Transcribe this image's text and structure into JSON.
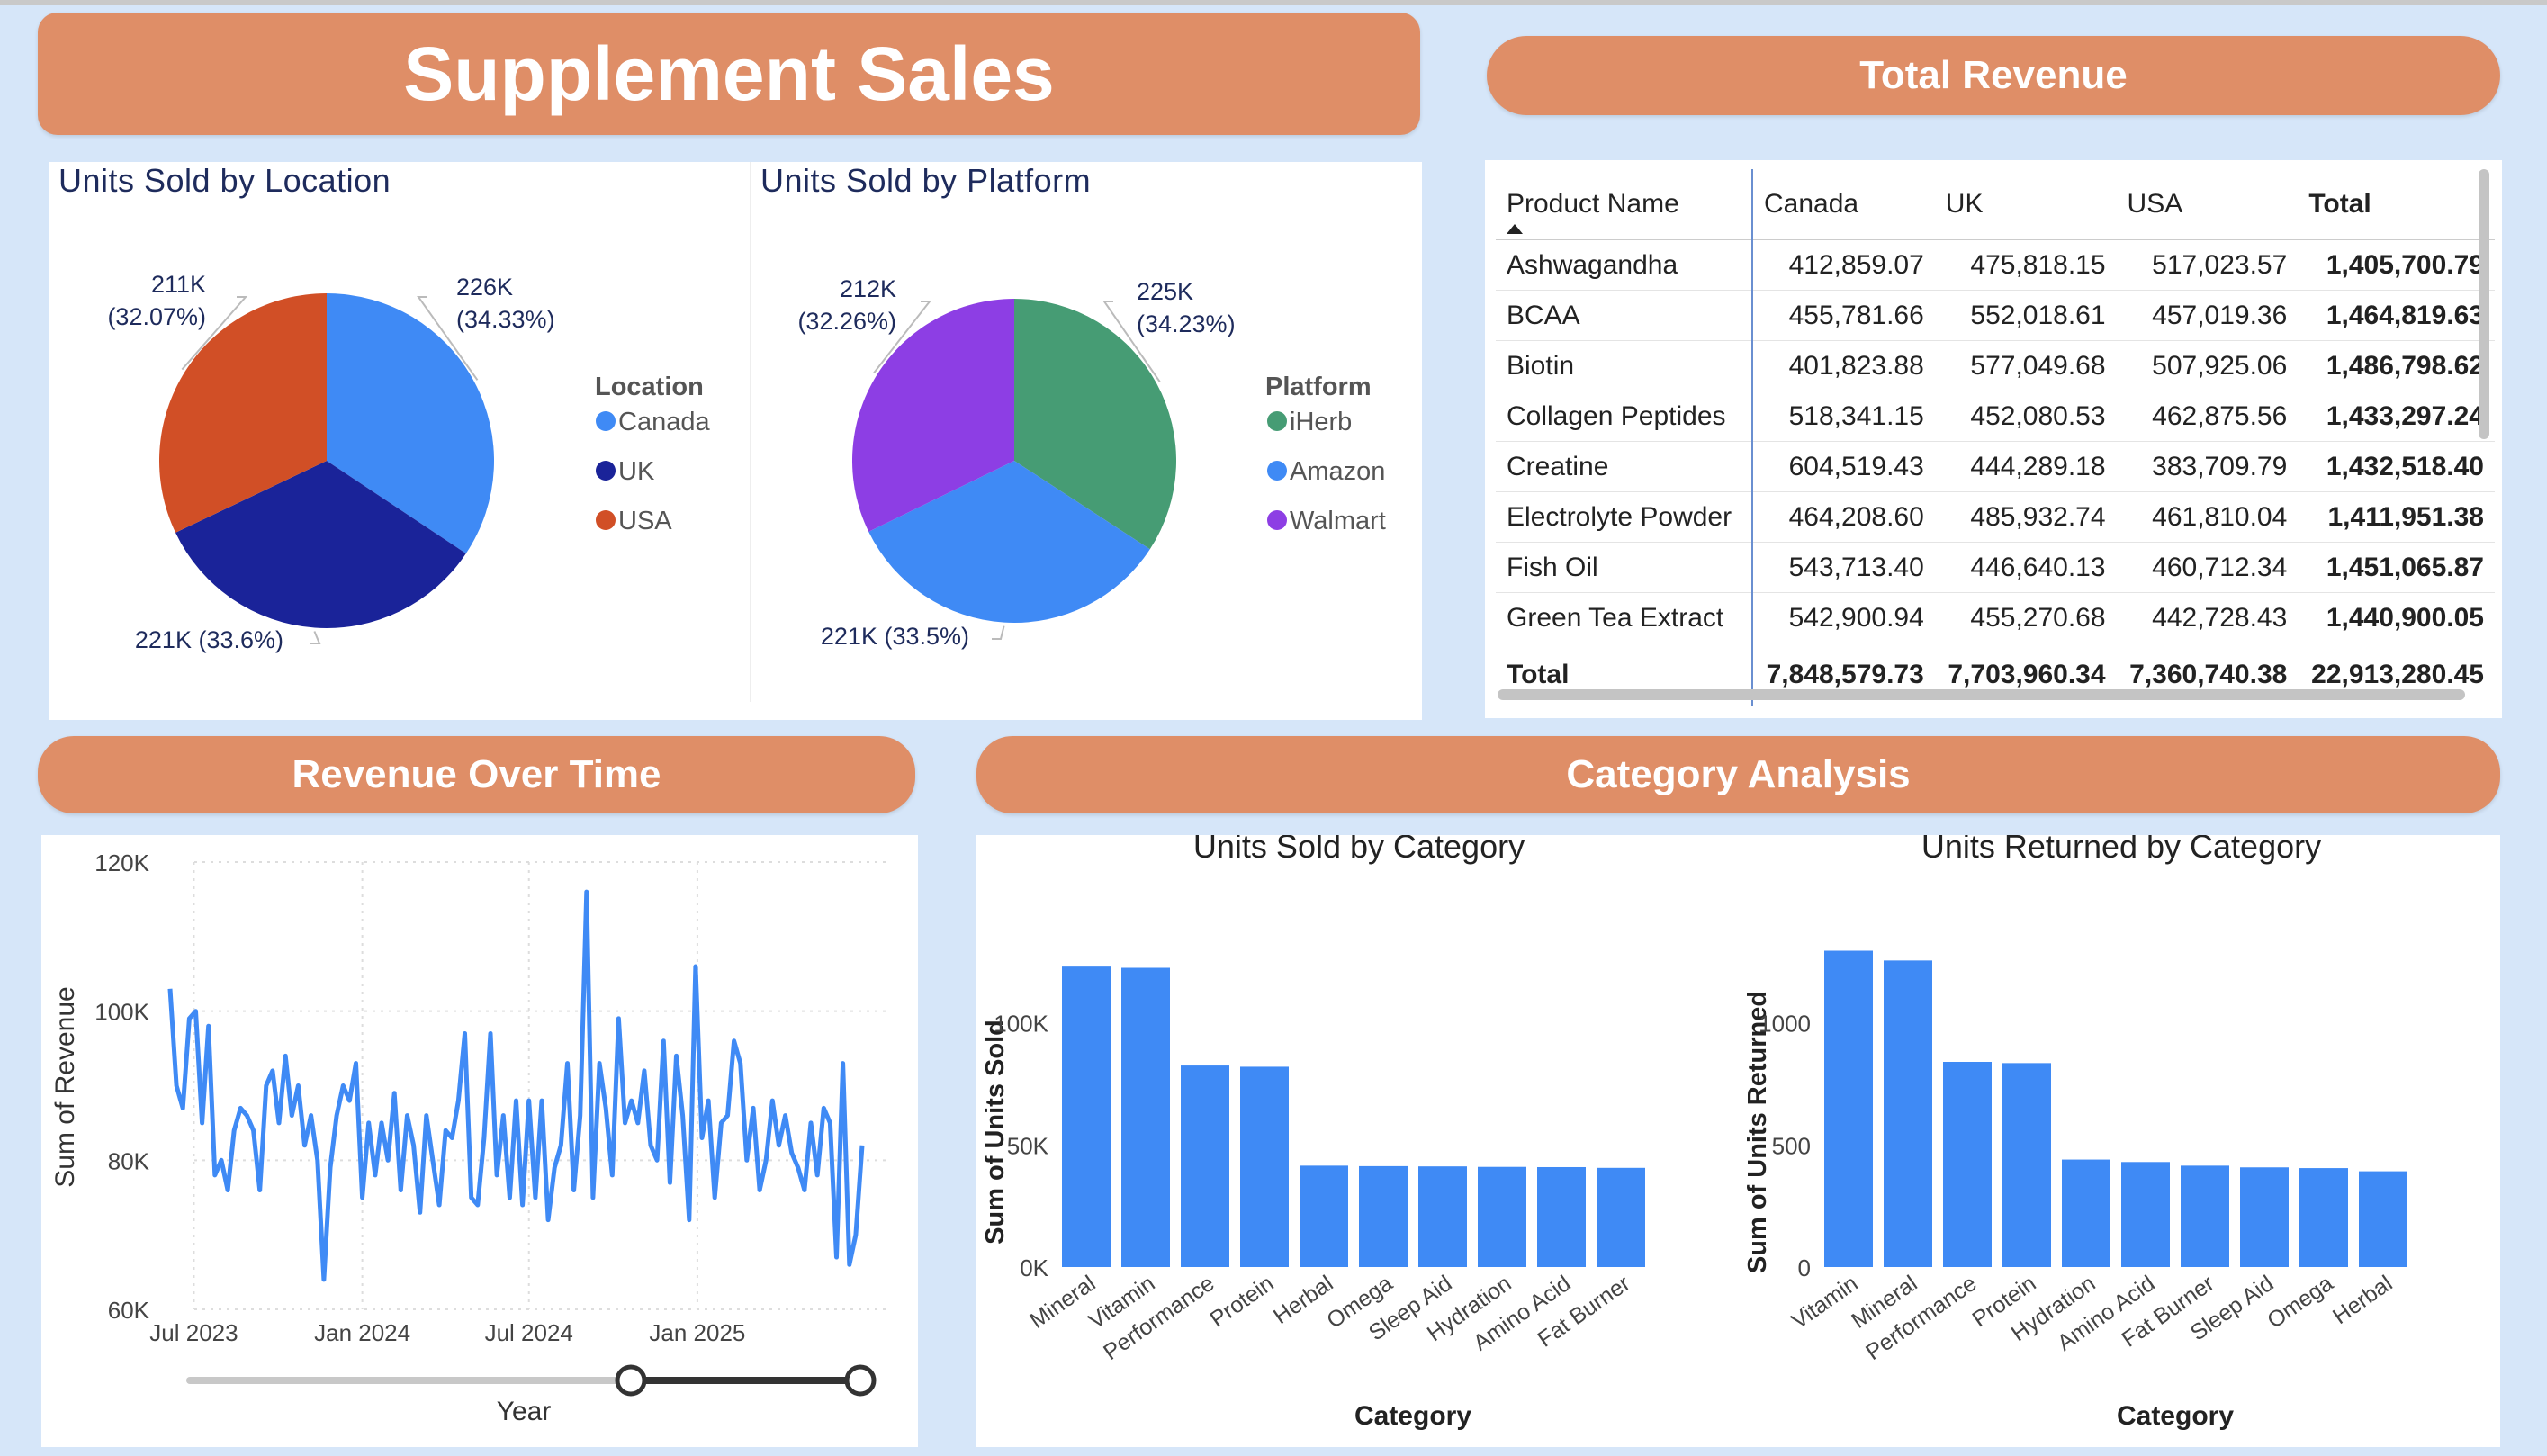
{
  "title": "Supplement Sales",
  "banners": {
    "total_revenue": "Total Revenue",
    "revenue_over_time": "Revenue Over Time",
    "category_analysis": "Category Analysis"
  },
  "colors": {
    "banner": "#df8e67",
    "canada": "#3f8af5",
    "uk": "#1a2399",
    "usa": "#d14f26",
    "iherb": "#469c74",
    "amazon": "#3f8af5",
    "walmart": "#8d3ee4",
    "bar": "#3f8af5",
    "line": "#3f8af5"
  },
  "location_pie": {
    "title": "Units Sold by Location",
    "legend_title": "Location",
    "slices": [
      {
        "name": "Canada",
        "value": 226,
        "label1": "226K",
        "label2": "(34.33%)",
        "color": "#3f8af5"
      },
      {
        "name": "UK",
        "value": 221,
        "label1": "221K (33.6%)",
        "label2": "",
        "color": "#1a2399"
      },
      {
        "name": "USA",
        "value": 211,
        "label1": "211K",
        "label2": "(32.07%)",
        "color": "#d14f26"
      }
    ]
  },
  "platform_pie": {
    "title": "Units Sold by Platform",
    "legend_title": "Platform",
    "slices": [
      {
        "name": "iHerb",
        "value": 225,
        "label1": "225K",
        "label2": "(34.23%)",
        "color": "#469c74"
      },
      {
        "name": "Amazon",
        "value": 221,
        "label1": "221K (33.5%)",
        "label2": "",
        "color": "#3f8af5"
      },
      {
        "name": "Walmart",
        "value": 212,
        "label1": "212K",
        "label2": "(32.26%)",
        "color": "#8d3ee4"
      }
    ]
  },
  "revenue_table": {
    "headers": [
      "Product Name",
      "Canada",
      "UK",
      "USA",
      "Total"
    ],
    "rows": [
      [
        "Ashwagandha",
        "412,859.07",
        "475,818.15",
        "517,023.57",
        "1,405,700.79"
      ],
      [
        "BCAA",
        "455,781.66",
        "552,018.61",
        "457,019.36",
        "1,464,819.63"
      ],
      [
        "Biotin",
        "401,823.88",
        "577,049.68",
        "507,925.06",
        "1,486,798.62"
      ],
      [
        "Collagen Peptides",
        "518,341.15",
        "452,080.53",
        "462,875.56",
        "1,433,297.24"
      ],
      [
        "Creatine",
        "604,519.43",
        "444,289.18",
        "383,709.79",
        "1,432,518.40"
      ],
      [
        "Electrolyte Powder",
        "464,208.60",
        "485,932.74",
        "461,810.04",
        "1,411,951.38"
      ],
      [
        "Fish Oil",
        "543,713.40",
        "446,640.13",
        "460,712.34",
        "1,451,065.87"
      ],
      [
        "Green Tea Extract",
        "542,900.94",
        "455,270.68",
        "442,728.43",
        "1,440,900.05"
      ]
    ],
    "total": [
      "Total",
      "7,848,579.73",
      "7,703,960.34",
      "7,360,740.38",
      "22,913,280.45"
    ]
  },
  "line_chart": {
    "ylabel": "Sum of Revenue",
    "xlabel": "Year",
    "ytick_labels": [
      "120K",
      "100K",
      "80K",
      "60K"
    ],
    "xtick_labels": [
      "Jul 2023",
      "Jan 2024",
      "Jul 2024",
      "Jan 2025"
    ]
  },
  "chart_data": [
    {
      "type": "line",
      "title": "",
      "xlabel": "Year",
      "ylabel": "Sum of Revenue",
      "ylim": [
        60000,
        120000
      ],
      "x_start": "2023-06-05",
      "x_interval": "week",
      "series": [
        {
          "values": [
            103000,
            90000,
            87000,
            99000,
            100000,
            85000,
            98000,
            78000,
            80000,
            76000,
            84000,
            87000,
            86000,
            84000,
            76000,
            90000,
            92000,
            85000,
            94000,
            86000,
            90000,
            82000,
            86000,
            80000,
            64000,
            79000,
            86000,
            90000,
            88000,
            93000,
            75000,
            85000,
            78000,
            85000,
            80000,
            89000,
            76000,
            86000,
            82000,
            73000,
            86000,
            80000,
            74000,
            84000,
            83000,
            88000,
            97000,
            75000,
            74000,
            83000,
            97000,
            78000,
            86000,
            75000,
            88000,
            74000,
            88000,
            75000,
            88000,
            72000,
            79000,
            82000,
            93000,
            76000,
            86000,
            116000,
            75000,
            93000,
            87000,
            78000,
            99000,
            85000,
            88000,
            85000,
            92000,
            82000,
            80000,
            96000,
            77000,
            94000,
            86000,
            72000,
            106000,
            83000,
            88000,
            75000,
            85000,
            86000,
            96000,
            93000,
            80000,
            87000,
            76000,
            80000,
            88000,
            82000,
            86000,
            81000,
            79000,
            76000,
            85000,
            78000,
            87000,
            85000,
            67000,
            93000,
            66000,
            70000,
            82000
          ]
        }
      ]
    },
    {
      "type": "bar",
      "title": "Units Sold by Category",
      "xlabel": "Category",
      "ylabel": "Sum of Units Sold",
      "ylim": [
        0,
        140000
      ],
      "ytick_labels": [
        "100K",
        "50K",
        "0K"
      ],
      "categories": [
        "Mineral",
        "Vitamin",
        "Performance",
        "Protein",
        "Herbal",
        "Omega",
        "Sleep Aid",
        "Hydration",
        "Amino Acid",
        "Fat Burner"
      ],
      "values": [
        123000,
        122500,
        82500,
        82000,
        41500,
        41300,
        41200,
        41000,
        40900,
        40600
      ]
    },
    {
      "type": "bar",
      "title": "Units Returned by Category",
      "xlabel": "Category",
      "ylabel": "Sum of Units Returned",
      "ylim": [
        0,
        1400
      ],
      "ytick_labels": [
        "1000",
        "500",
        "0"
      ],
      "categories": [
        "Vitamin",
        "Mineral",
        "Performance",
        "Protein",
        "Hydration",
        "Amino Acid",
        "Fat Burner",
        "Sleep Aid",
        "Omega",
        "Herbal"
      ],
      "values": [
        1295,
        1255,
        840,
        835,
        440,
        430,
        415,
        408,
        405,
        392
      ]
    }
  ]
}
